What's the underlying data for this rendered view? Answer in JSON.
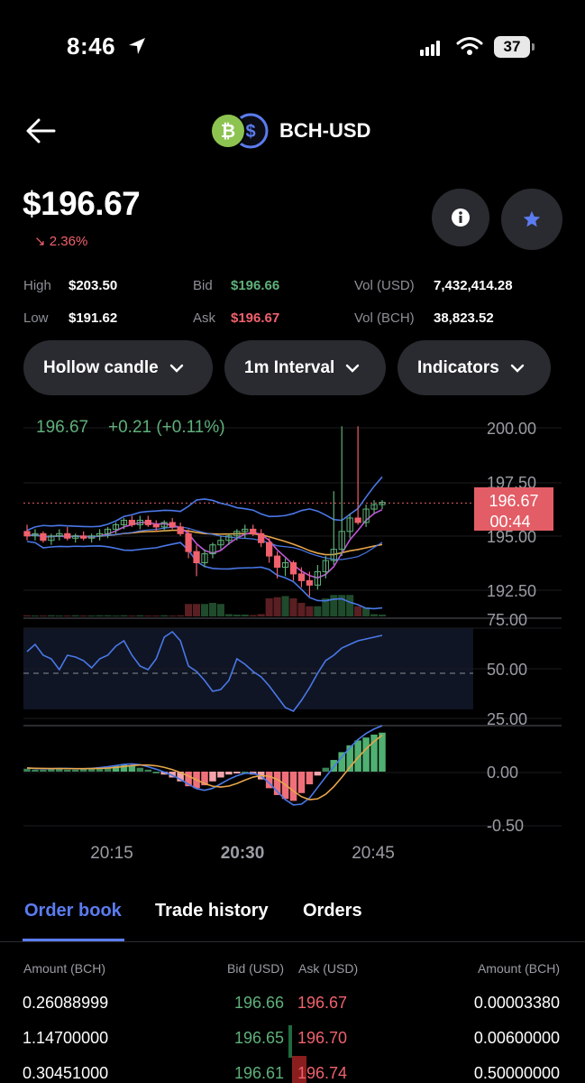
{
  "status": {
    "time": "8:46",
    "battery": "37"
  },
  "header": {
    "pair": "BCH-USD"
  },
  "price": {
    "value": "$196.67",
    "change": "2.36%"
  },
  "stats": {
    "high_label": "High",
    "high": "$203.50",
    "low_label": "Low",
    "low": "$191.62",
    "bid_label": "Bid",
    "bid": "$196.66",
    "ask_label": "Ask",
    "ask": "$196.67",
    "vol_usd_label": "Vol (USD)",
    "vol_usd": "7,432,414.28",
    "vol_bch_label": "Vol (BCH)",
    "vol_bch": "38,823.52"
  },
  "controls": {
    "chart_type": "Hollow candle",
    "interval": "1m Interval",
    "indicators": "Indicators"
  },
  "chart_data": {
    "type": "candlestick",
    "legend": {
      "price": "196.67",
      "change": "+0.21 (+0.11%)"
    },
    "price_axis": [
      "200.00",
      "197.50",
      "195.00",
      "192.50"
    ],
    "ylim": [
      191.6,
      200.6
    ],
    "current_price_tag": "196.67",
    "countdown_tag": "00:44",
    "rsi_axis": [
      "75.00",
      "50.00",
      "25.00"
    ],
    "macd_axis": [
      "0.00",
      "-0.50"
    ],
    "time_labels": [
      "20:15",
      "20:30",
      "20:45"
    ],
    "candles": [
      {
        "o": 195.4,
        "h": 195.7,
        "l": 195.0,
        "c": 195.2
      },
      {
        "o": 195.2,
        "h": 195.5,
        "l": 195.0,
        "c": 195.3
      },
      {
        "o": 195.3,
        "h": 195.4,
        "l": 194.9,
        "c": 195.0
      },
      {
        "o": 195.0,
        "h": 195.3,
        "l": 194.8,
        "c": 195.2
      },
      {
        "o": 195.2,
        "h": 195.5,
        "l": 195.0,
        "c": 195.3
      },
      {
        "o": 195.3,
        "h": 195.6,
        "l": 195.0,
        "c": 195.1
      },
      {
        "o": 195.1,
        "h": 195.3,
        "l": 194.9,
        "c": 195.2
      },
      {
        "o": 195.2,
        "h": 195.4,
        "l": 195.0,
        "c": 195.1
      },
      {
        "o": 195.1,
        "h": 195.3,
        "l": 194.9,
        "c": 195.2
      },
      {
        "o": 195.2,
        "h": 195.5,
        "l": 195.0,
        "c": 195.3
      },
      {
        "o": 195.3,
        "h": 195.6,
        "l": 195.1,
        "c": 195.5
      },
      {
        "o": 195.5,
        "h": 195.8,
        "l": 195.3,
        "c": 195.7
      },
      {
        "o": 195.7,
        "h": 196.0,
        "l": 195.5,
        "c": 195.9
      },
      {
        "o": 195.9,
        "h": 196.1,
        "l": 195.6,
        "c": 195.7
      },
      {
        "o": 195.7,
        "h": 196.1,
        "l": 195.5,
        "c": 195.9
      },
      {
        "o": 195.9,
        "h": 196.1,
        "l": 195.6,
        "c": 195.7
      },
      {
        "o": 195.7,
        "h": 195.9,
        "l": 195.4,
        "c": 195.6
      },
      {
        "o": 195.6,
        "h": 195.9,
        "l": 195.4,
        "c": 195.8
      },
      {
        "o": 195.8,
        "h": 196.0,
        "l": 195.5,
        "c": 195.6
      },
      {
        "o": 195.6,
        "h": 195.8,
        "l": 195.2,
        "c": 195.3
      },
      {
        "o": 195.3,
        "h": 195.5,
        "l": 194.2,
        "c": 194.5
      },
      {
        "o": 194.5,
        "h": 194.8,
        "l": 193.4,
        "c": 194.0
      },
      {
        "o": 194.0,
        "h": 194.6,
        "l": 193.8,
        "c": 194.4
      },
      {
        "o": 194.4,
        "h": 194.9,
        "l": 194.2,
        "c": 194.8
      },
      {
        "o": 194.8,
        "h": 195.2,
        "l": 194.6,
        "c": 195.0
      },
      {
        "o": 195.0,
        "h": 195.3,
        "l": 194.8,
        "c": 195.2
      },
      {
        "o": 195.2,
        "h": 195.5,
        "l": 195.0,
        "c": 195.4
      },
      {
        "o": 195.4,
        "h": 195.7,
        "l": 195.1,
        "c": 195.5
      },
      {
        "o": 195.5,
        "h": 195.7,
        "l": 195.2,
        "c": 195.3
      },
      {
        "o": 195.3,
        "h": 195.5,
        "l": 194.7,
        "c": 194.9
      },
      {
        "o": 194.9,
        "h": 195.1,
        "l": 194.0,
        "c": 194.3
      },
      {
        "o": 194.3,
        "h": 194.5,
        "l": 193.3,
        "c": 193.8
      },
      {
        "o": 193.8,
        "h": 194.2,
        "l": 193.4,
        "c": 194.0
      },
      {
        "o": 194.0,
        "h": 194.1,
        "l": 193.2,
        "c": 193.5
      },
      {
        "o": 193.5,
        "h": 193.8,
        "l": 192.9,
        "c": 193.2
      },
      {
        "o": 193.2,
        "h": 193.6,
        "l": 192.5,
        "c": 193.0
      },
      {
        "o": 193.0,
        "h": 193.9,
        "l": 192.8,
        "c": 193.6
      },
      {
        "o": 193.6,
        "h": 194.3,
        "l": 193.3,
        "c": 194.1
      },
      {
        "o": 194.1,
        "h": 197.2,
        "l": 193.9,
        "c": 194.6
      },
      {
        "o": 194.6,
        "h": 200.1,
        "l": 194.3,
        "c": 195.4
      },
      {
        "o": 195.4,
        "h": 196.2,
        "l": 195.1,
        "c": 196.0
      },
      {
        "o": 196.0,
        "h": 200.1,
        "l": 195.7,
        "c": 195.8
      },
      {
        "o": 195.8,
        "h": 196.6,
        "l": 195.6,
        "c": 196.4
      },
      {
        "o": 196.4,
        "h": 196.8,
        "l": 196.2,
        "c": 196.6
      },
      {
        "o": 196.6,
        "h": 196.8,
        "l": 196.4,
        "c": 196.7
      }
    ],
    "volumes": [
      0.05,
      0.04,
      0.04,
      0.05,
      0.04,
      0.04,
      0.05,
      0.04,
      0.04,
      0.05,
      0.05,
      0.04,
      0.05,
      0.04,
      0.05,
      0.04,
      0.04,
      0.05,
      0.04,
      0.05,
      0.55,
      0.55,
      0.55,
      0.6,
      0.55,
      0.1,
      0.08,
      0.08,
      0.06,
      0.1,
      0.8,
      0.85,
      0.9,
      0.8,
      0.6,
      0.45,
      0.45,
      0.8,
      0.95,
      0.95,
      0.95,
      0.45,
      0.4,
      0.1,
      0.08
    ],
    "rsi": [
      62,
      66,
      60,
      58,
      52,
      60,
      59,
      57,
      53,
      58,
      60,
      65,
      68,
      60,
      54,
      52,
      58,
      70,
      73,
      68,
      54,
      51,
      46,
      40,
      41,
      46,
      58,
      55,
      51,
      48,
      43,
      37,
      31,
      29,
      35,
      42,
      50,
      57,
      60,
      64,
      66,
      68,
      69,
      70,
      71
    ],
    "macd_hist": [
      0.03,
      0.02,
      0.02,
      0.03,
      0.03,
      0.02,
      0.02,
      0.03,
      0.03,
      0.04,
      0.05,
      0.06,
      0.07,
      0.06,
      0.04,
      0.02,
      0.0,
      -0.03,
      -0.06,
      -0.1,
      -0.15,
      -0.17,
      -0.14,
      -0.1,
      -0.06,
      -0.03,
      -0.01,
      0.0,
      -0.03,
      -0.08,
      -0.17,
      -0.24,
      -0.28,
      -0.3,
      -0.22,
      -0.13,
      -0.04,
      0.04,
      0.12,
      0.2,
      0.27,
      0.32,
      0.35,
      0.38,
      0.4
    ]
  },
  "tabs": [
    "Order book",
    "Trade history",
    "Orders"
  ],
  "orderbook": {
    "headers": {
      "amount_left": "Amount (BCH)",
      "bid": "Bid (USD)",
      "ask": "Ask (USD)",
      "amount_right": "Amount (BCH)"
    },
    "rows": [
      {
        "amount_bid": "0.26088999",
        "bid": "196.66",
        "ask": "196.67",
        "amount_ask": "0.00003380"
      },
      {
        "amount_bid": "1.14700000",
        "bid": "196.65",
        "ask": "196.70",
        "amount_ask": "0.00600000"
      },
      {
        "amount_bid": "0.30451000",
        "bid": "196.61",
        "ask": "196.74",
        "amount_ask": "0.50000000"
      }
    ]
  },
  "colors": {
    "up": "#5fb07a",
    "down": "#f0616d",
    "accent": "#5b7cf0",
    "bg": "#000000",
    "surface": "#2a2b30"
  }
}
